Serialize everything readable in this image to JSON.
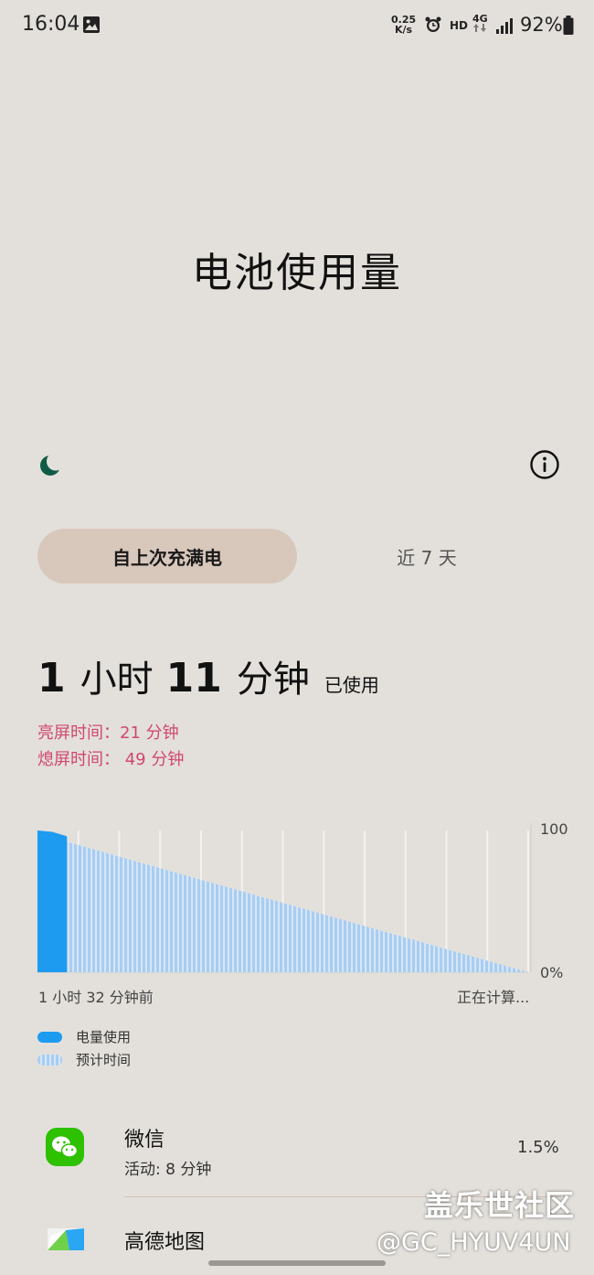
{
  "status_bar": {
    "time": "16:04",
    "net_speed_value": "0.25",
    "net_speed_unit": "K/s",
    "hd": "HD",
    "network": "4G",
    "battery": "92%"
  },
  "header": {
    "title": "电池使用量"
  },
  "tabs": [
    {
      "label": "自上次充满电",
      "active": true
    },
    {
      "label": "近 7 天",
      "active": false
    }
  ],
  "usage": {
    "hours": "1",
    "hours_unit": "小时",
    "minutes": "11",
    "minutes_unit": "分钟",
    "used_label": "已使用",
    "screen_on": "亮屏时间：21 分钟",
    "screen_off": "熄屏时间： 49 分钟"
  },
  "chart_data": {
    "type": "area",
    "y_ticks": [
      "100",
      "0%"
    ],
    "ylim": [
      0,
      100
    ],
    "x_labels": [
      "1 小时 32 分钟前",
      "正在计算..."
    ],
    "series": [
      {
        "name": "电量使用",
        "color": "#1d9bf0",
        "points": [
          [
            0,
            100
          ],
          [
            0.6,
            99
          ],
          [
            1.2,
            96
          ]
        ]
      },
      {
        "name": "预计时间",
        "color": "#a8cdf2",
        "points": [
          [
            1.2,
            92
          ],
          [
            20,
            0
          ]
        ]
      }
    ],
    "grid": true
  },
  "legend": [
    {
      "label": "电量使用",
      "color": "#1d9bf0"
    },
    {
      "label": "预计时间",
      "color": "#a8cdf2"
    }
  ],
  "apps": [
    {
      "name": "微信",
      "activity": "活动: 8 分钟",
      "percent": "1.5%",
      "icon": "wechat-icon",
      "icon_color": "#2dc100"
    },
    {
      "name": "高德地图",
      "icon": "amap-icon"
    }
  ],
  "watermark": {
    "line1": "盖乐世社区",
    "line2": "@GC_HYUV4UN"
  }
}
